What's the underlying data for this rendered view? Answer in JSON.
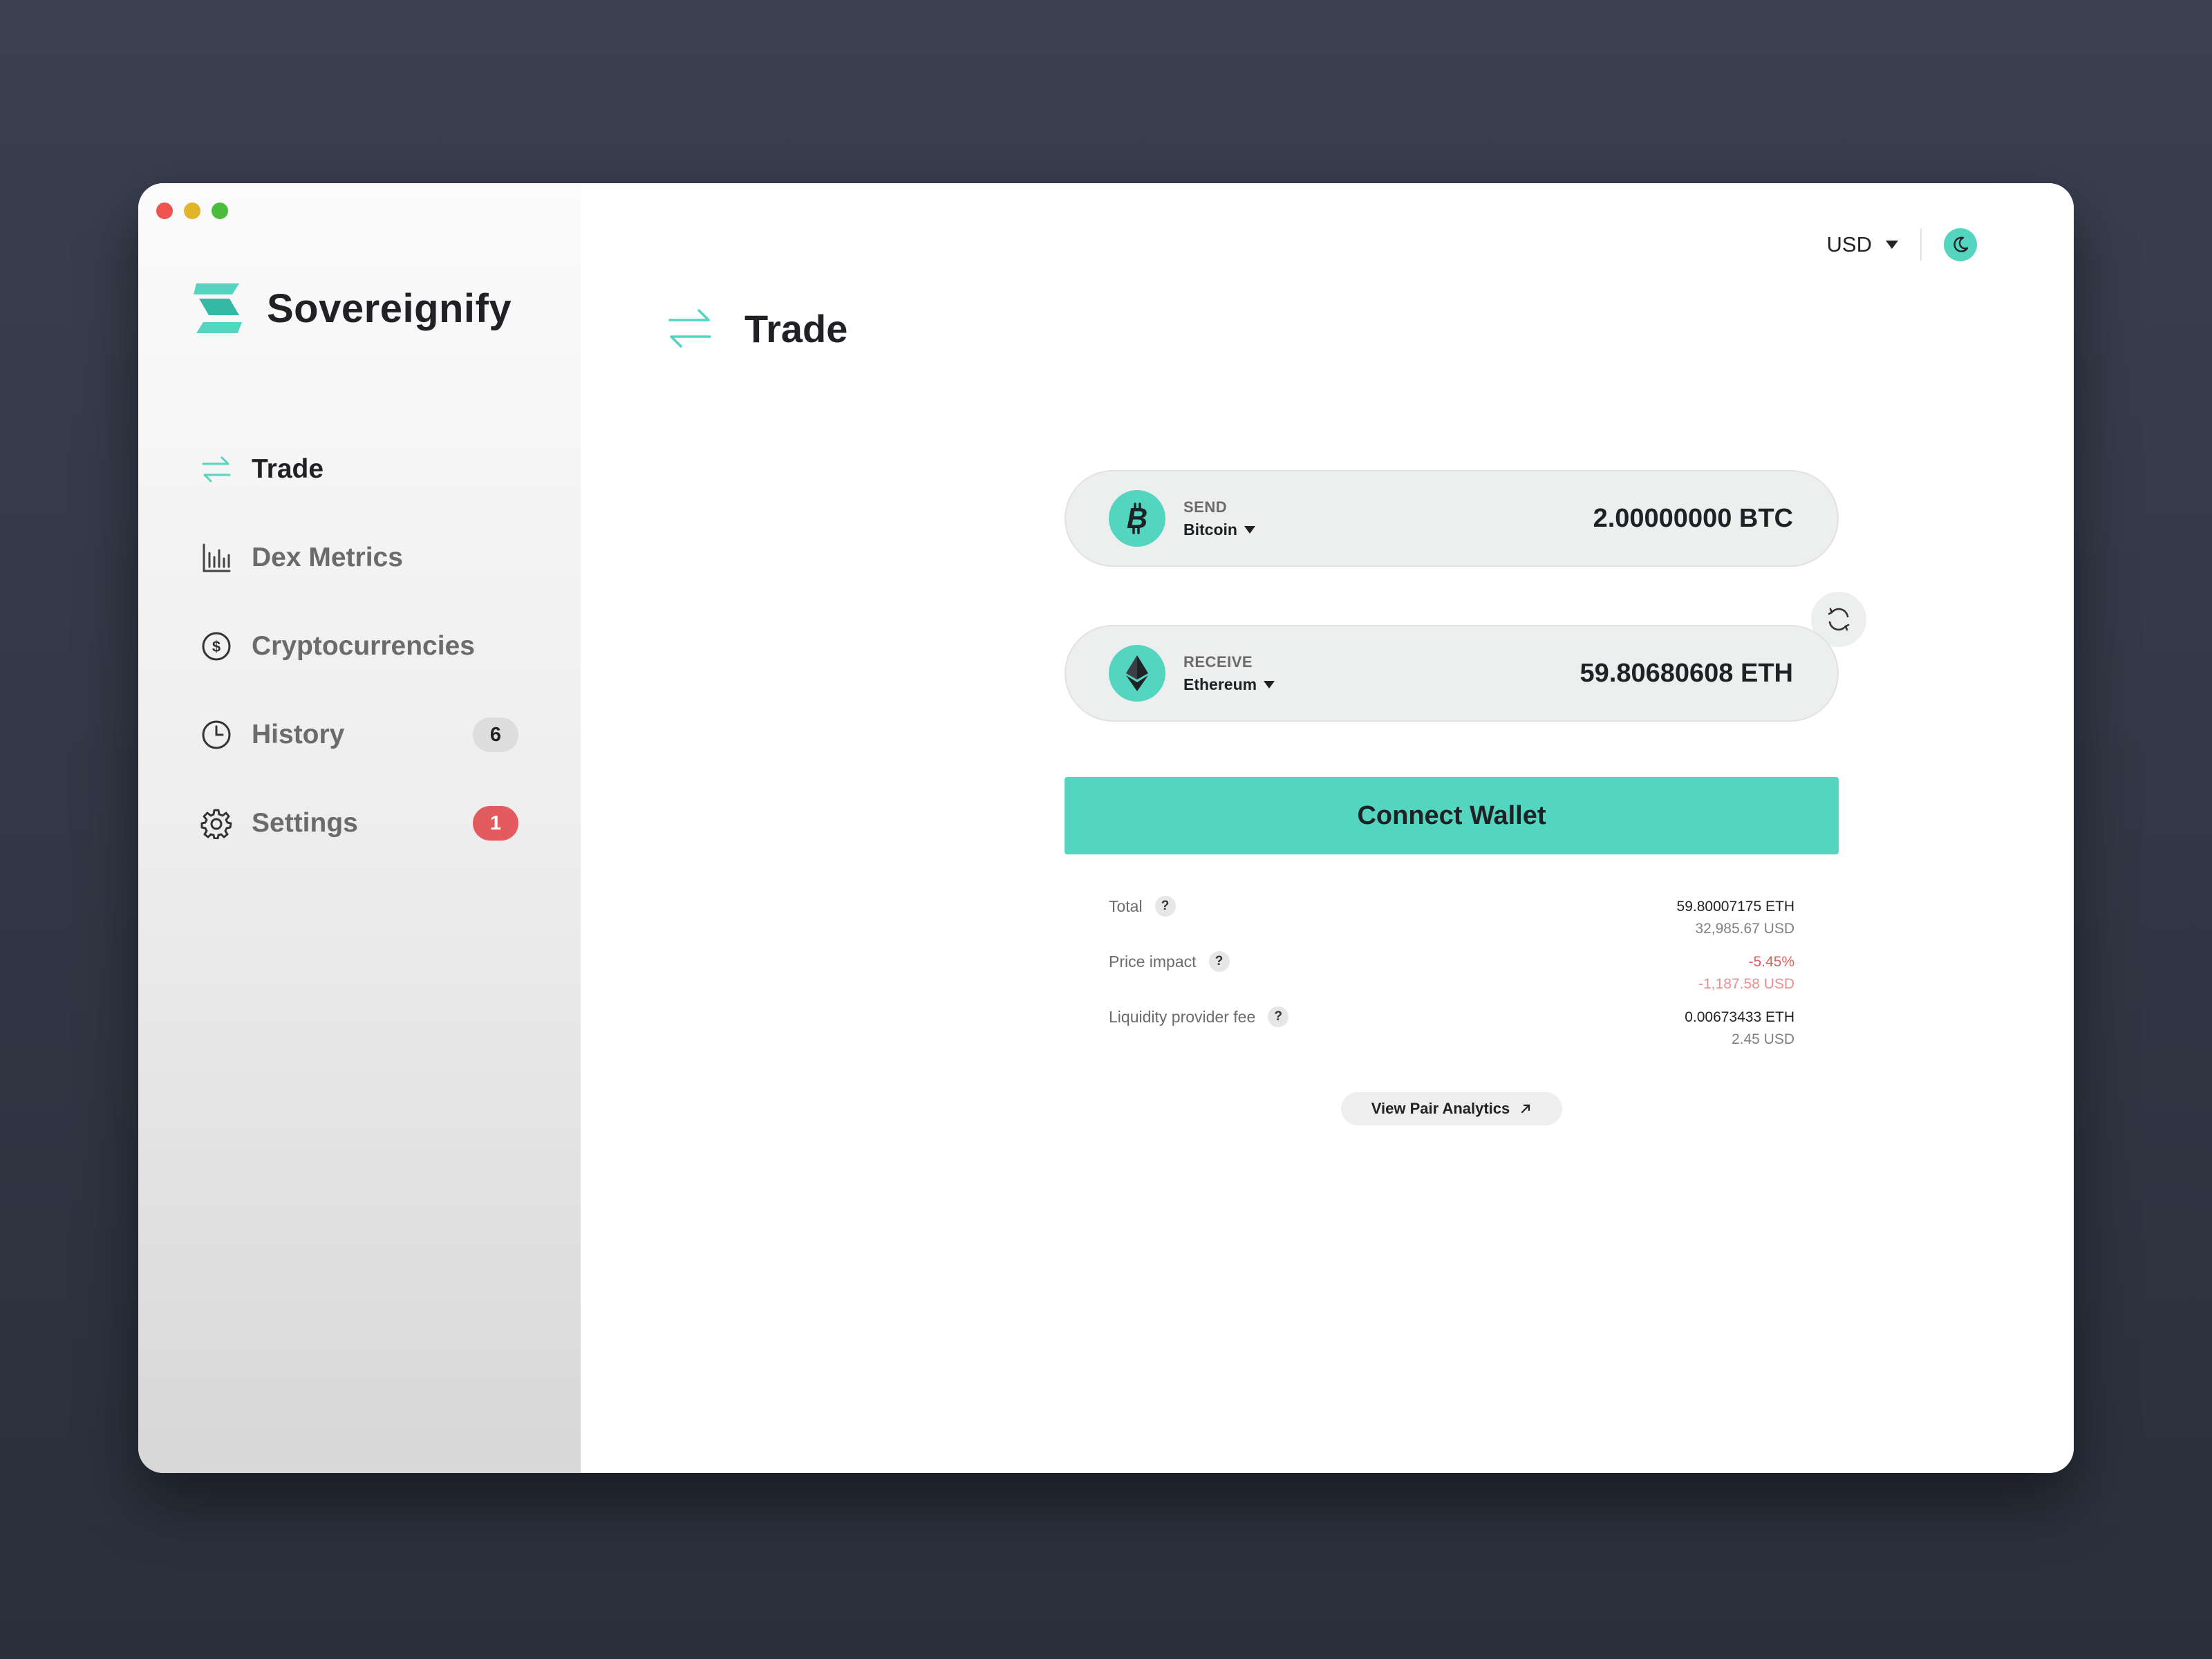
{
  "app": {
    "name": "Sovereignify"
  },
  "sidebar": {
    "items": [
      {
        "label": "Trade",
        "active": true,
        "badge": ""
      },
      {
        "label": "Dex Metrics",
        "active": false,
        "badge": ""
      },
      {
        "label": "Cryptocurrencies",
        "active": false,
        "badge": ""
      },
      {
        "label": "History",
        "active": false,
        "badge": "6"
      },
      {
        "label": "Settings",
        "active": false,
        "badge": "1"
      }
    ]
  },
  "header": {
    "title": "Trade"
  },
  "topbar": {
    "currency": "USD",
    "theme_icon": "moon-icon"
  },
  "swap": {
    "send": {
      "kind": "SEND",
      "asset": "Bitcoin",
      "amount": "2.00000000 BTC",
      "icon": "bitcoin-icon"
    },
    "receive": {
      "kind": "RECEIVE",
      "asset": "Ethereum",
      "amount": "59.80680608 ETH",
      "icon": "ethereum-icon"
    },
    "connect_label": "Connect Wallet"
  },
  "details": {
    "help_glyph": "?",
    "rows": [
      {
        "label": "Total",
        "main": "59.80007175 ETH",
        "sub": "32,985.67 USD"
      },
      {
        "label": "Price impact",
        "main": "-5.45%",
        "sub": "-1,187.58 USD"
      },
      {
        "label": "Liquidity provider fee",
        "main": "0.00673433 ETH",
        "sub": "2.45 USD"
      }
    ]
  },
  "analytics": {
    "label": "View Pair Analytics"
  },
  "colors": {
    "accent": "#53d5c0",
    "danger": "#e35b5e",
    "danger_light": "#f08c8e",
    "text": "#1f2125",
    "muted": "#6b6b6b"
  }
}
